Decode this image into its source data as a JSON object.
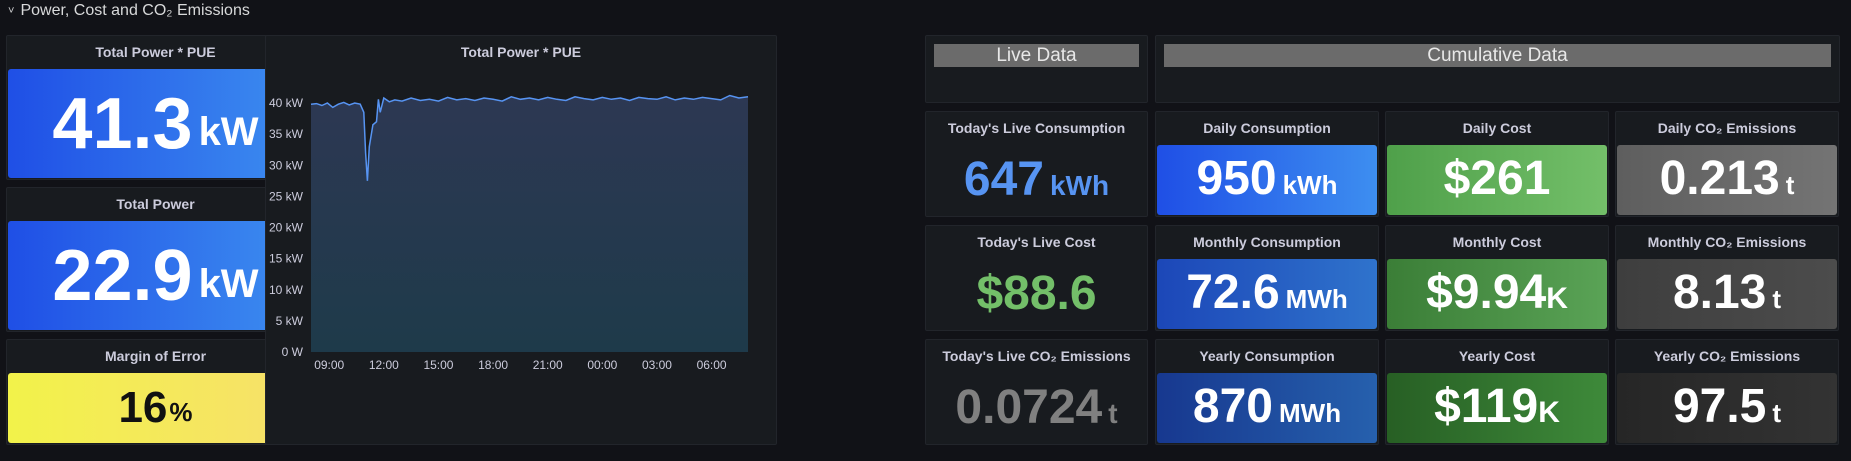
{
  "row": {
    "title": "Power, Cost and CO₂ Emissions",
    "chevron": "˅"
  },
  "left_stats": [
    {
      "title": "Total Power * PUE",
      "value": "41.3",
      "unit": "kW",
      "color_from": "#1f4fe6",
      "color_to": "#3d8ef0"
    },
    {
      "title": "Total Power",
      "value": "22.9",
      "unit": "kW",
      "color_from": "#1f4fe6",
      "color_to": "#3d8ef0"
    },
    {
      "title": "Margin of Error",
      "value": "16",
      "unit": "%",
      "color_from": "#f2f24a",
      "color_to": "#f7e06b"
    }
  ],
  "chart_panel": {
    "title": "Total Power * PUE",
    "chart_data": {
      "type": "area",
      "title": "Total Power * PUE",
      "yticks": [
        "40 kW",
        "35 kW",
        "30 kW",
        "25 kW",
        "20 kW",
        "15 kW",
        "10 kW",
        "5 kW",
        "0 W"
      ],
      "xticks": [
        "09:00",
        "12:00",
        "15:00",
        "18:00",
        "21:00",
        "00:00",
        "03:00",
        "06:00"
      ],
      "ylim": [
        0,
        40
      ],
      "y_unit": "kW",
      "x_unit": "hours",
      "x_start_hour": 8.0,
      "x_end_hour": 32.0,
      "series": [
        {
          "name": "",
          "x": [
            8.0,
            8.3,
            8.6,
            8.9,
            9.2,
            9.5,
            9.8,
            10.1,
            10.4,
            10.7,
            10.9,
            11.0,
            11.1,
            11.2,
            11.4,
            11.6,
            11.7,
            11.8,
            12.0,
            12.3,
            12.6,
            13.0,
            13.5,
            14.0,
            14.5,
            15.0,
            15.5,
            16.0,
            16.5,
            17.0,
            17.5,
            18.0,
            18.5,
            19.0,
            19.5,
            20.0,
            20.5,
            21.0,
            21.5,
            22.0,
            22.5,
            23.0,
            23.5,
            24.0,
            24.5,
            25.0,
            25.5,
            26.0,
            26.5,
            27.0,
            27.5,
            28.0,
            28.5,
            29.0,
            29.5,
            30.0,
            30.5,
            31.0,
            31.5,
            32.0
          ],
          "values": [
            39.8,
            39.9,
            39.6,
            40.0,
            39.3,
            39.8,
            40.1,
            39.7,
            40.0,
            39.8,
            38.5,
            32.0,
            27.5,
            33.0,
            36.5,
            37.0,
            40.6,
            38.5,
            40.8,
            40.2,
            40.5,
            40.3,
            40.8,
            40.4,
            40.6,
            40.3,
            40.9,
            40.5,
            40.7,
            40.4,
            40.8,
            40.6,
            40.3,
            41.0,
            40.6,
            40.8,
            40.5,
            40.9,
            40.6,
            40.4,
            41.0,
            40.7,
            40.5,
            40.9,
            40.6,
            40.8,
            40.4,
            40.9,
            40.7,
            40.6,
            41.0,
            40.5,
            40.8,
            40.6,
            40.9,
            40.7,
            40.5,
            41.2,
            40.8,
            41.0
          ]
        }
      ],
      "line_color": "#5794f2",
      "fill_top": "#2d3853",
      "fill_bottom": "#1e3a4a"
    }
  },
  "live_header": "Live Data",
  "cumulative_header": "Cumulative Data",
  "live_stats": [
    {
      "title": "Today's Live Consumption",
      "value": "647",
      "unit": "kWh",
      "color": "#5794f2"
    },
    {
      "title": "Today's Live Cost",
      "value": "$88.6",
      "unit": "",
      "color": "#73bf69"
    },
    {
      "title": "Today's Live CO₂ Emissions",
      "value": "0.0724",
      "unit": "t",
      "color": "#808080"
    }
  ],
  "cumulative_stats": [
    [
      {
        "title": "Daily Consumption",
        "value": "950",
        "unit": "kWh",
        "color_from": "#1f4fe6",
        "color_to": "#3d8ef0"
      },
      {
        "title": "Daily Cost",
        "value": "$261",
        "unit": "",
        "color_from": "#4fa04a",
        "color_to": "#73bf69"
      },
      {
        "title": "Daily CO₂ Emissions",
        "value": "0.213",
        "unit": "t",
        "color_from": "#5e5e5e",
        "color_to": "#747474"
      }
    ],
    [
      {
        "title": "Monthly Consumption",
        "value": "72.6",
        "unit": "MWh",
        "color_from": "#1c47b8",
        "color_to": "#2f73cc"
      },
      {
        "title": "Monthly Cost",
        "value": "$9.94",
        "unit": "K",
        "color_from": "#3b7e37",
        "color_to": "#5aa356"
      },
      {
        "title": "Monthly CO₂ Emissions",
        "value": "8.13",
        "unit": "t",
        "color_from": "#3e3e3e",
        "color_to": "#4c4c4c"
      }
    ],
    [
      {
        "title": "Yearly Consumption",
        "value": "870",
        "unit": "MWh",
        "color_from": "#17388f",
        "color_to": "#2660ad"
      },
      {
        "title": "Yearly Cost",
        "value": "$119",
        "unit": "K",
        "color_from": "#275f24",
        "color_to": "#3e8a3a"
      },
      {
        "title": "Yearly CO₂ Emissions",
        "value": "97.5",
        "unit": "t",
        "color_from": "#262626",
        "color_to": "#333333"
      }
    ]
  ]
}
